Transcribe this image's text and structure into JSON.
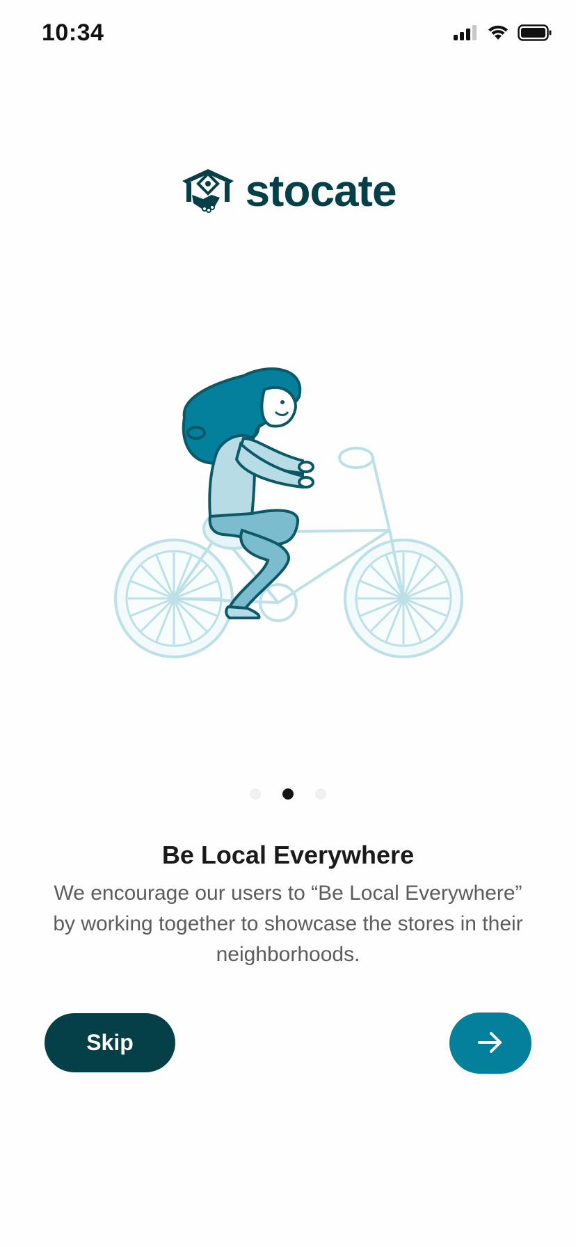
{
  "status_bar": {
    "time": "10:34",
    "icons": [
      "cellular-signal-icon",
      "wifi-icon",
      "battery-icon"
    ]
  },
  "logo": {
    "wordmark": "stocate",
    "icon": "storefront-handshake-icon",
    "color": "#053f47"
  },
  "illustration": {
    "subject": "woman-riding-bicycle",
    "colors": {
      "dark": "#0b5866",
      "hair": "#047f9c",
      "shirt": "#b7dce5",
      "pants": "#7bbcce",
      "bike": "#bde0e8"
    }
  },
  "pager": {
    "count": 3,
    "active_index": 1
  },
  "onboarding": {
    "title": "Be Local Everywhere",
    "description": "We encourage our users to “Be Local Everywhere” by working together to showcase the stores in their neighborhoods."
  },
  "actions": {
    "skip_label": "Skip",
    "next_icon": "arrow-right-icon",
    "skip_color": "#053f47",
    "next_color": "#047f9c"
  }
}
